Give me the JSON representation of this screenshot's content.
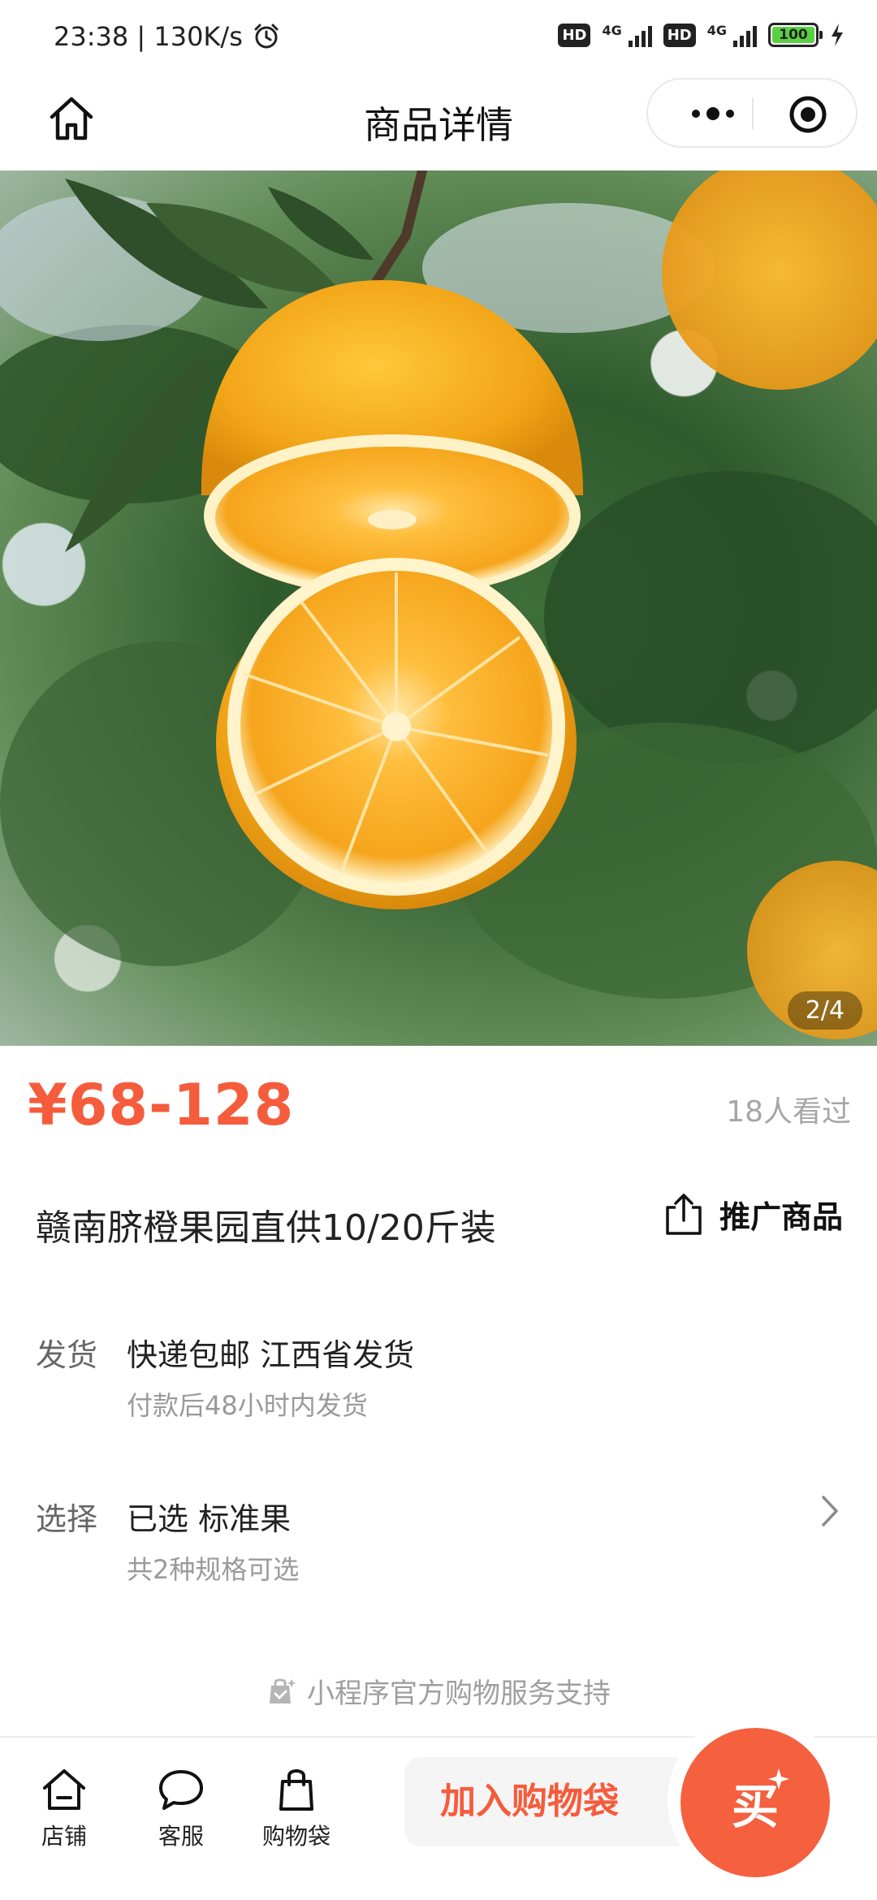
{
  "status_bar": {
    "time_speed": "23:38 | 130K/s",
    "hd_label": "HD",
    "network_label": "4G",
    "battery_level": "100"
  },
  "nav": {
    "title": "商品详情"
  },
  "gallery": {
    "counter": "2/4"
  },
  "product": {
    "price": "¥68-128",
    "views": "18人看过",
    "title": "赣南脐橙果园直供10/20斤装",
    "promote_label": "推广商品"
  },
  "shipping": {
    "label": "发货",
    "value": "快递包邮 江西省发货",
    "note": "付款后48小时内发货"
  },
  "selection": {
    "label": "选择",
    "value": "已选 标准果",
    "note": "共2种规格可选"
  },
  "support_text": "小程序官方购物服务支持",
  "bottom_bar": {
    "store_label": "店铺",
    "service_label": "客服",
    "bag_label": "购物袋",
    "add_to_bag": "加入购物袋",
    "buy": "买"
  },
  "colors": {
    "accent": "#f55c3c",
    "battery_fill": "#5bd042"
  }
}
